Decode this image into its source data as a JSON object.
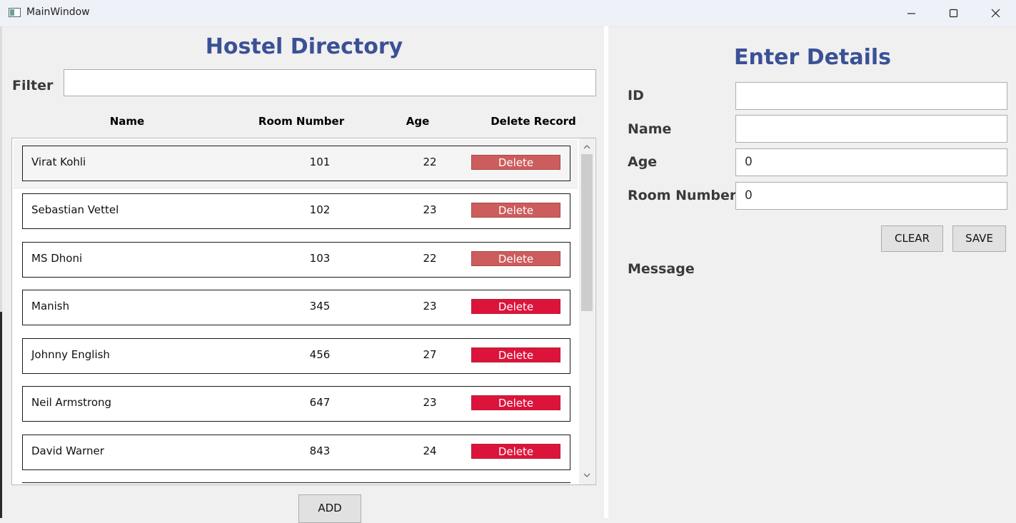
{
  "window": {
    "title": "MainWindow"
  },
  "left": {
    "title": "Hostel Directory",
    "filter_label": "Filter",
    "filter_value": "",
    "columns": [
      "Name",
      "Room Number",
      "Age",
      "Delete Record"
    ],
    "rows": [
      {
        "name": "Virat Kohli",
        "room": "101",
        "age": "22",
        "action": "Delete"
      },
      {
        "name": "Sebastian Vettel",
        "room": "102",
        "age": "23",
        "action": "Delete"
      },
      {
        "name": "MS Dhoni",
        "room": "103",
        "age": "22",
        "action": "Delete"
      },
      {
        "name": "Manish",
        "room": "345",
        "age": "23",
        "action": "Delete"
      },
      {
        "name": "Johnny English",
        "room": "456",
        "age": "27",
        "action": "Delete"
      },
      {
        "name": "Neil Armstrong",
        "room": "647",
        "age": "23",
        "action": "Delete"
      },
      {
        "name": "David Warner",
        "room": "843",
        "age": "24",
        "action": "Delete"
      }
    ],
    "add_label": "ADD"
  },
  "right": {
    "title": "Enter Details",
    "fields": [
      {
        "label": "ID",
        "value": ""
      },
      {
        "label": "Name",
        "value": ""
      },
      {
        "label": "Age",
        "value": "0"
      },
      {
        "label": "Room Number",
        "value": "0"
      }
    ],
    "clear_label": "CLEAR",
    "save_label": "SAVE",
    "message_label": "Message"
  },
  "colors": {
    "heading": "#3b5196",
    "delete_muted": "#cd5c5c",
    "delete_active": "#dc143c"
  }
}
